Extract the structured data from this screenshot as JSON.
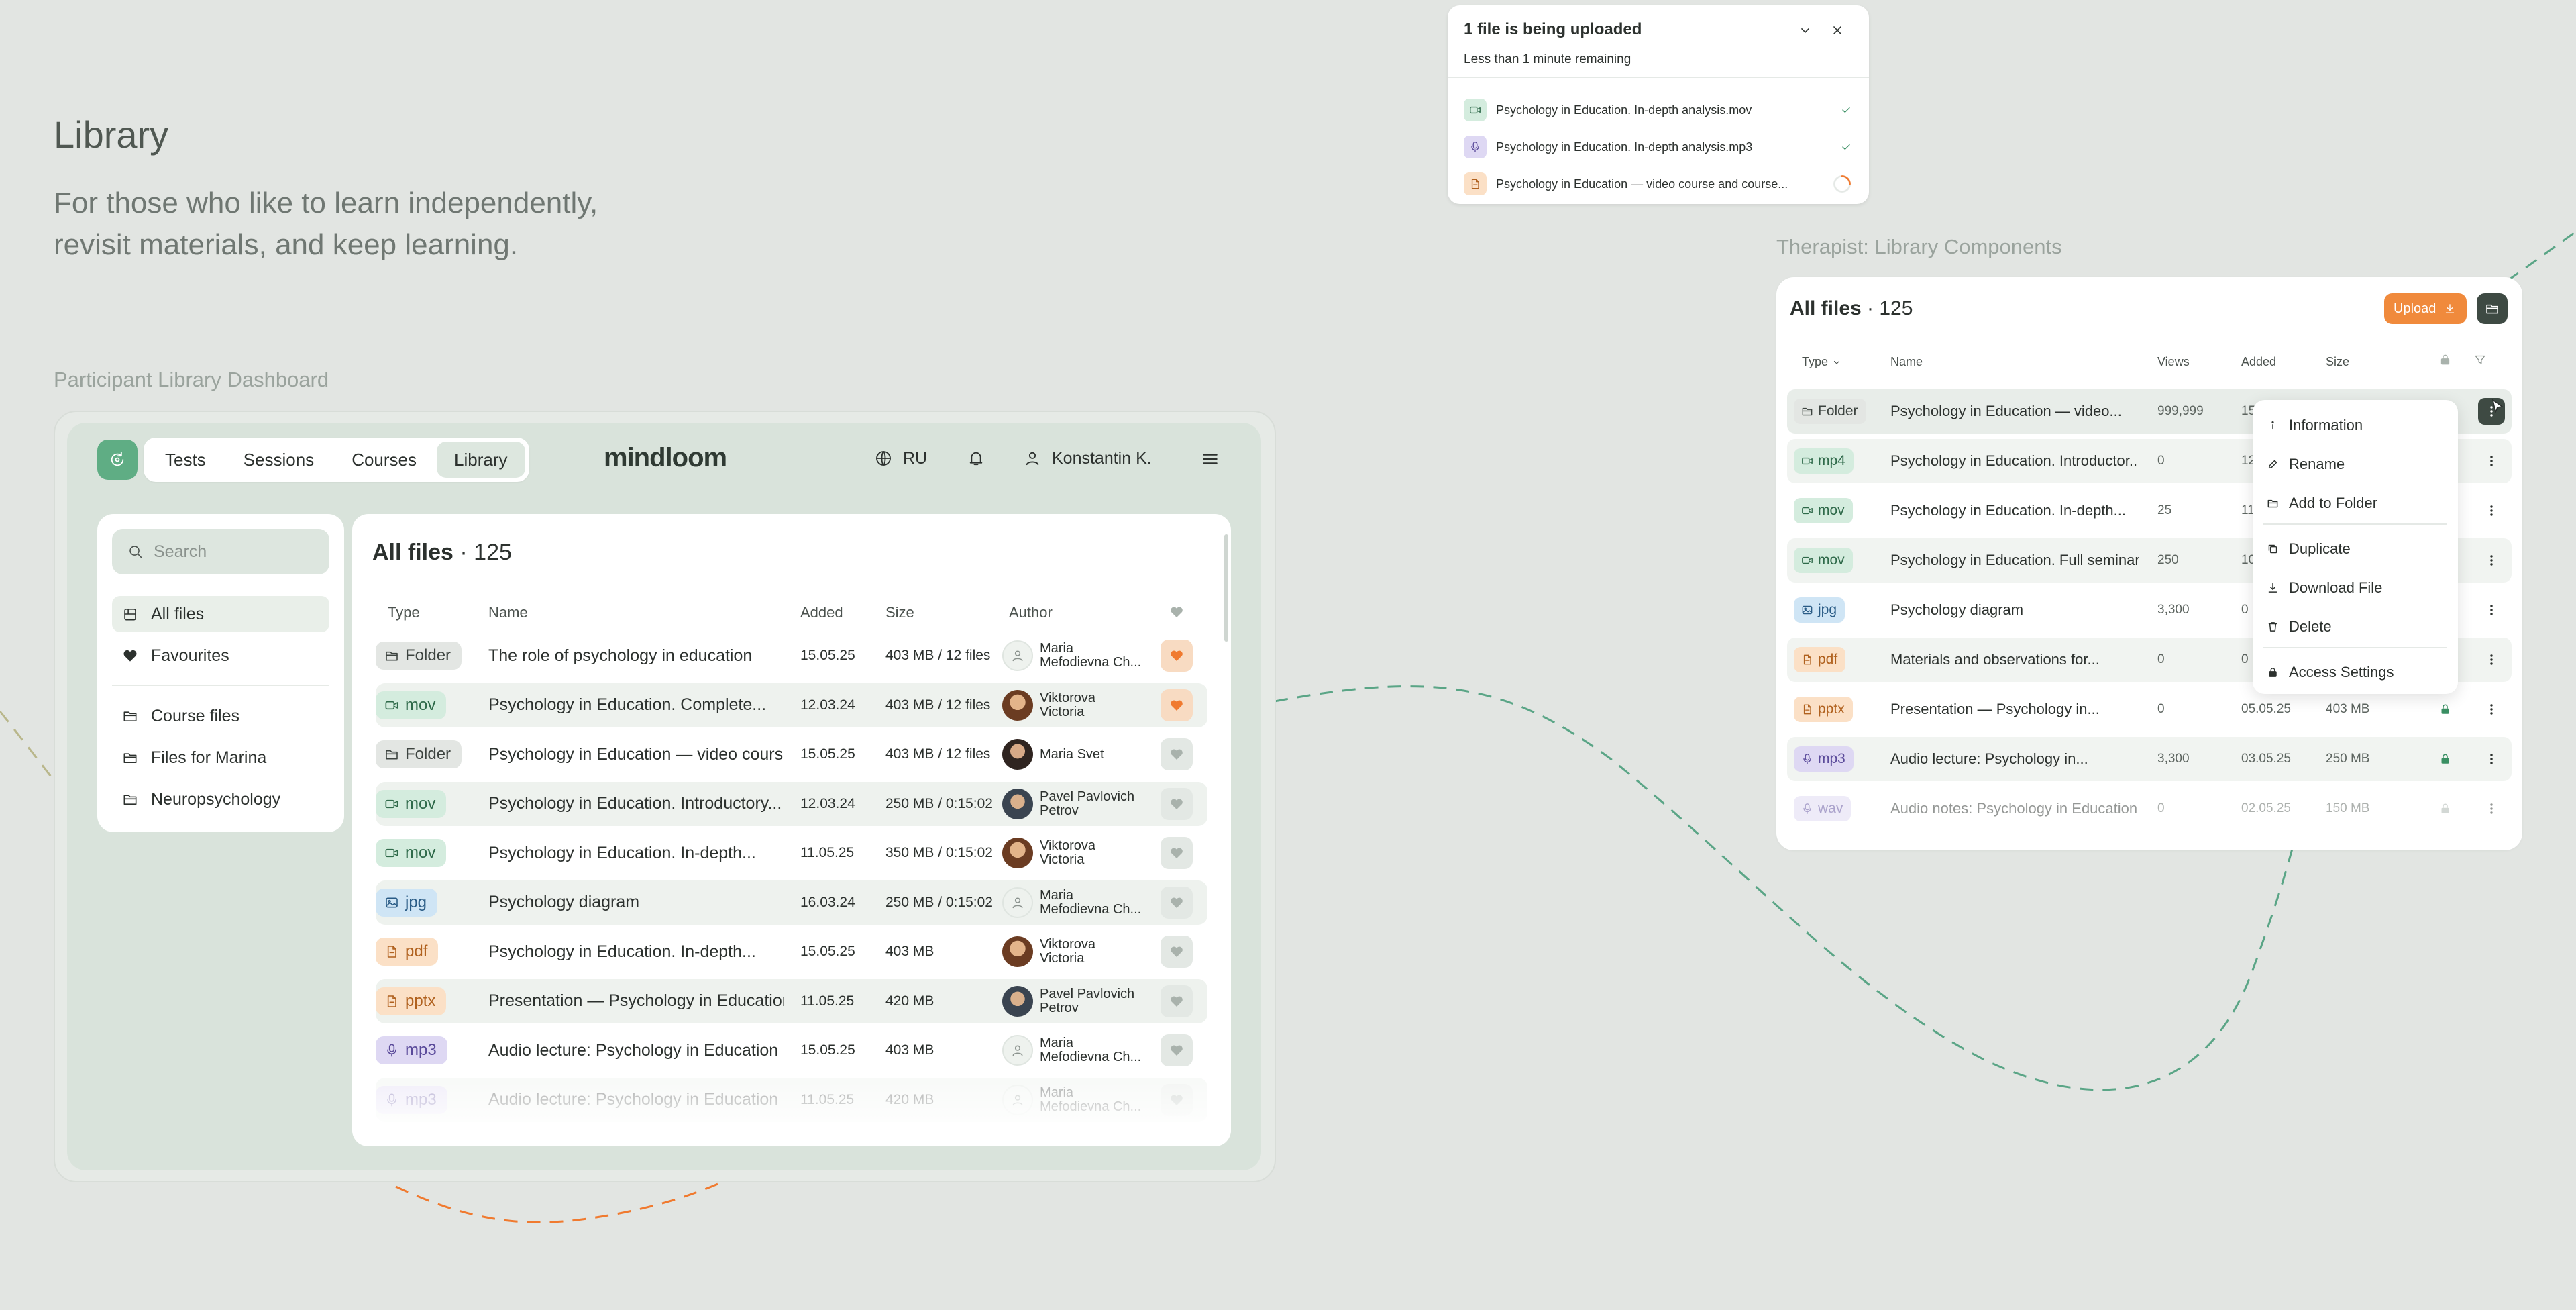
{
  "intro": {
    "title": "Library",
    "subtitle_line1": "For those who like to learn independently,",
    "subtitle_line2": "revisit materials, and keep learning.",
    "participant_label": "Participant Library Dashboard",
    "therapist_label": "Therapist: Library Components"
  },
  "participant": {
    "nav_tabs": [
      "Tests",
      "Sessions",
      "Courses",
      "Library"
    ],
    "active_tab": "Library",
    "brand": "mindloom",
    "language": "RU",
    "user_name": "Konstantin K.",
    "search_placeholder": "Search",
    "sidebar": {
      "all_files": "All files",
      "favourites": "Favourites",
      "folders": [
        "Course files",
        "Files for Marina",
        "Neuropsychology"
      ]
    },
    "title": "All files",
    "count": "· 125",
    "columns": {
      "type": "Type",
      "name": "Name",
      "added": "Added",
      "size": "Size",
      "author": "Author"
    },
    "rows": [
      {
        "type": "Folder",
        "name": "The role of psychology in education",
        "added": "15.05.25",
        "size": "403 MB / 12 files",
        "author1": "Maria",
        "author2": "Mefodievna Ch...",
        "favourite": true
      },
      {
        "type": "mov",
        "name": "Psychology in Education. Complete...",
        "added": "12.03.24",
        "size": "403 MB / 12 files",
        "author1": "Viktorova",
        "author2": "Victoria",
        "favourite": true
      },
      {
        "type": "Folder",
        "name": "Psychology in Education — video cours...",
        "added": "15.05.25",
        "size": "403 MB / 12 files",
        "author1": "Maria Svet",
        "author2": "",
        "favourite": false
      },
      {
        "type": "mov",
        "name": "Psychology in Education. Introductory...",
        "added": "12.03.24",
        "size": "250 MB / 0:15:02",
        "author1": "Pavel Pavlovich",
        "author2": "Petrov",
        "favourite": false
      },
      {
        "type": "mov",
        "name": "Psychology in Education. In-depth...",
        "added": "11.05.25",
        "size": "350 MB / 0:15:02",
        "author1": "Viktorova",
        "author2": "Victoria",
        "favourite": false
      },
      {
        "type": "jpg",
        "name": "Psychology diagram",
        "added": "16.03.24",
        "size": "250 MB / 0:15:02",
        "author1": "Maria",
        "author2": "Mefodievna Ch...",
        "favourite": false
      },
      {
        "type": "pdf",
        "name": "Psychology in Education. In-depth...",
        "added": "15.05.25",
        "size": "403 MB",
        "author1": "Viktorova",
        "author2": "Victoria",
        "favourite": false
      },
      {
        "type": "pptx",
        "name": "Presentation — Psychology in Education",
        "added": "11.05.25",
        "size": "420 MB",
        "author1": "Pavel Pavlovich",
        "author2": "Petrov",
        "favourite": false
      },
      {
        "type": "mp3",
        "name": "Audio lecture: Psychology in Education",
        "added": "15.05.25",
        "size": "403 MB",
        "author1": "Maria",
        "author2": "Mefodievna Ch...",
        "favourite": false
      },
      {
        "type": "mp3",
        "name": "Audio lecture: Psychology in Education",
        "added": "11.05.25",
        "size": "420 MB",
        "author1": "Maria",
        "author2": "Mefodievna Ch...",
        "favourite": false
      }
    ]
  },
  "upload": {
    "title": "1 file is being uploaded",
    "subtitle": "Less than 1 minute remaining",
    "files": [
      {
        "name": "Psychology in Education. In-depth analysis.mov",
        "kind": "video",
        "status": "done"
      },
      {
        "name": "Psychology in Education. In-depth analysis.mp3",
        "kind": "audio",
        "status": "done"
      },
      {
        "name": "Psychology in Education — video course and course...",
        "kind": "doc",
        "status": "uploading"
      }
    ]
  },
  "therapist": {
    "title": "All files",
    "count": "· 125",
    "upload_label": "Upload",
    "columns": {
      "type": "Type",
      "name": "Name",
      "views": "Views",
      "added": "Added",
      "size": "Size"
    },
    "rows": [
      {
        "type": "Folder",
        "name": "Psychology in Education — video...",
        "views": "999,999",
        "added": "15",
        "size": "",
        "lock": ""
      },
      {
        "type": "mp4",
        "name": "Psychology in Education. Introductor...",
        "views": "0",
        "added": "12",
        "size": "",
        "lock": ""
      },
      {
        "type": "mov",
        "name": "Psychology in Education. In-depth...",
        "views": "25",
        "added": "11",
        "size": "",
        "lock": ""
      },
      {
        "type": "mov",
        "name": "Psychology in Education. Full seminar",
        "views": "250",
        "added": "10",
        "size": "",
        "lock": ""
      },
      {
        "type": "jpg",
        "name": "Psychology diagram",
        "views": "3,300",
        "added": "0",
        "size": "",
        "lock": ""
      },
      {
        "type": "pdf",
        "name": "Materials and observations for...",
        "views": "0",
        "added": "0",
        "size": "",
        "lock": ""
      },
      {
        "type": "pptx",
        "name": "Presentation — Psychology in...",
        "views": "0",
        "added": "05.05.25",
        "size": "403 MB",
        "lock": "green"
      },
      {
        "type": "mp3",
        "name": "Audio lecture: Psychology in...",
        "views": "3,300",
        "added": "03.05.25",
        "size": "250 MB",
        "lock": "green"
      },
      {
        "type": "wav",
        "name": "Audio notes: Psychology in Education",
        "views": "0",
        "added": "02.05.25",
        "size": "150 MB",
        "lock": "grey"
      }
    ],
    "menu": [
      "Information",
      "Rename",
      "Add to Folder",
      "Duplicate",
      "Download File",
      "Delete",
      "Access Settings"
    ]
  },
  "colors": {
    "accent": "#5fad84",
    "orange": "#f07a2f",
    "background": "#e2e5e2",
    "dashed_line_green": "#5aa586",
    "dashed_line_orange": "#f07a2f"
  }
}
